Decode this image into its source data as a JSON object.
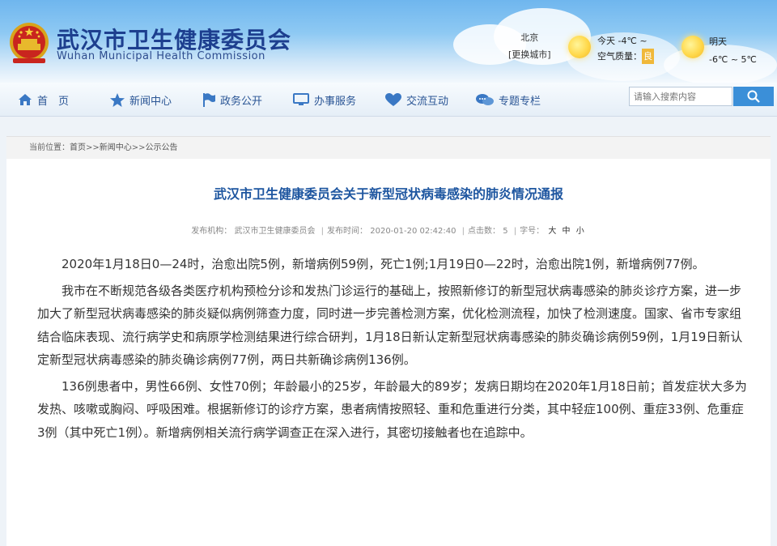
{
  "site": {
    "title_cn": "武汉市卫生健康委员会",
    "title_en": "Wuhan Municipal Health Commission"
  },
  "weather": {
    "city": "北京",
    "switch_city": "[更换城市]",
    "today_label": "今天",
    "today_temp": "-4℃ ~",
    "air_quality_label": "空气质量：",
    "air_quality_value": "良",
    "tomorrow_label": "明天",
    "tomorrow_temp": "-6℃ ~ 5℃",
    "colors": {
      "aq_badge": "#f0b83a",
      "sun": "#ffd84a"
    }
  },
  "nav": {
    "items": [
      {
        "label": "首　页",
        "icon": "home-icon"
      },
      {
        "label": "新闻中心",
        "icon": "star-icon"
      },
      {
        "label": "政务公开",
        "icon": "flag-icon"
      },
      {
        "label": "办事服务",
        "icon": "monitor-icon"
      },
      {
        "label": "交流互动",
        "icon": "heart-icon"
      },
      {
        "label": "专题专栏",
        "icon": "chat-icon"
      }
    ],
    "search_placeholder": "请输入搜索内容"
  },
  "breadcrumb": {
    "prefix": "当前位置：",
    "home": "首页",
    "sep": ">>",
    "news": "新闻中心",
    "current": "公示公告"
  },
  "article": {
    "title": "武汉市卫生健康委员会关于新型冠状病毒感染的肺炎情况通报",
    "meta": {
      "org_label": "发布机构：",
      "org": "武汉市卫生健康委员会",
      "time_label": "发布时间：",
      "time": "2020-01-20 02:42:40",
      "clicks_label": "点击数：",
      "clicks": "5",
      "fontsize_label": "字号：",
      "size_large": "大",
      "size_medium": "中",
      "size_small": "小",
      "divider": "|"
    },
    "paragraphs": [
      "2020年1月18日0—24时，治愈出院5例，新增病例59例，死亡1例;1月19日0—22时，治愈出院1例，新增病例77例。",
      "我市在不断规范各级各类医疗机构预检分诊和发热门诊运行的基础上，按照新修订的新型冠状病毒感染的肺炎诊疗方案，进一步加大了新型冠状病毒感染的肺炎疑似病例筛查力度，同时进一步完善检测方案，优化检测流程，加快了检测速度。国家、省市专家组结合临床表现、流行病学史和病原学检测结果进行综合研判，1月18日新认定新型冠状病毒感染的肺炎确诊病例59例，1月19日新认定新型冠状病毒感染的肺炎确诊病例77例，两日共新确诊病例136例。",
      "136例患者中，男性66例、女性70例；年龄最小的25岁，年龄最大的89岁；发病日期均在2020年1月18日前；首发症状大多为发热、咳嗽或胸闷、呼吸困难。根据新修订的诊疗方案，患者病情按照轻、重和危重进行分类，其中轻症100例、重症33例、危重症3例（其中死亡1例）。新增病例相关流行病学调查正在深入进行，其密切接触者也在追踪中。"
    ]
  },
  "colors": {
    "brand_blue": "#1d3f8f",
    "title_blue": "#1e56a0",
    "nav_text": "#2a5595",
    "search_button": "#3b8fd8"
  }
}
